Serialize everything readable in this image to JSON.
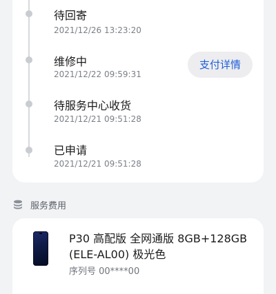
{
  "timeline": {
    "items": [
      {
        "status": "待回寄",
        "time": "2021/12/26 13:23:20"
      },
      {
        "status": "维修中",
        "time": "2021/12/22 09:59:31"
      },
      {
        "status": "待服务中心收货",
        "time": "2021/12/21 09:51:28"
      },
      {
        "status": "已申请",
        "time": "2021/12/21 09:51:28"
      }
    ],
    "pay_button_label": "支付详情"
  },
  "service_fee": {
    "title": "服务费用",
    "icon": "coins-stack-icon"
  },
  "product": {
    "name_line1": "P30 高配版 全网通版 8GB+128GB",
    "name_line2": "(ELE-AL00) 极光色",
    "serial_label": "序列号 00****00"
  },
  "colors": {
    "accent": "#1f5fd8",
    "background": "#f1f3f5",
    "card": "#ffffff"
  }
}
